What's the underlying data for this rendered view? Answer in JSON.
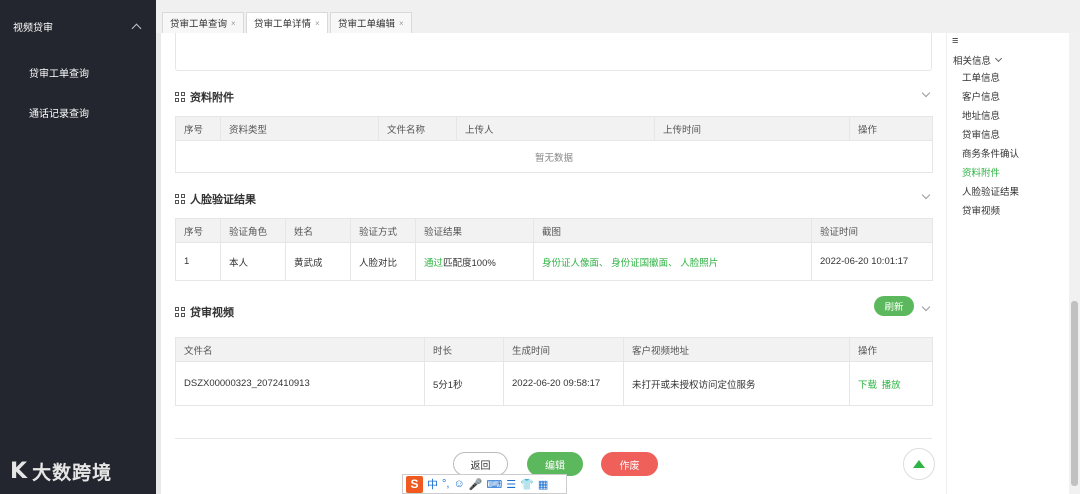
{
  "sidebar": {
    "group_label": "视频贷审",
    "items": [
      {
        "label": "贷审工单查询"
      },
      {
        "label": "通话记录查询"
      }
    ],
    "brand_mark": "K",
    "brand_text": "大数跨境"
  },
  "tabs": [
    {
      "label": "贷审工单查询"
    },
    {
      "label": "贷审工单详情"
    },
    {
      "label": "贷审工单编辑"
    }
  ],
  "tab_close_glyph": "×",
  "attachments": {
    "title": "资料附件",
    "columns": [
      "序号",
      "资料类型",
      "文件名称",
      "上传人",
      "上传时间",
      "操作"
    ],
    "empty_text": "暂无数据"
  },
  "face_verify": {
    "title": "人脸验证结果",
    "columns": [
      "序号",
      "验证角色",
      "姓名",
      "验证方式",
      "验证结果",
      "截图",
      "验证时间"
    ],
    "row": {
      "index": "1",
      "role": "本人",
      "name": "黄武成",
      "method": "人脸对比",
      "result_prefix": "通过",
      "result_suffix": "匹配度100%",
      "screenshots": "身份证人像面、 身份证国徽面、 人脸照片",
      "time": "2022-06-20 10:01:17"
    }
  },
  "video": {
    "title": "贷审视频",
    "refresh_label": "刷新",
    "columns": [
      "文件名",
      "时长",
      "生成时间",
      "客户视频地址",
      "操作"
    ],
    "row": {
      "filename": "DSZX00000323_2072410913",
      "duration": "5分1秒",
      "created": "2022-06-20 09:58:17",
      "address": "未打开或未授权访问定位服务",
      "action_download": "下载",
      "action_play": "播放"
    }
  },
  "actions": {
    "back": "返回",
    "edit": "编辑",
    "void": "作废"
  },
  "right_nav": {
    "menu_glyph": "≡",
    "heading": "相关信息",
    "items": [
      "工单信息",
      "客户信息",
      "地址信息",
      "贷审信息",
      "商务条件确认",
      "资料附件",
      "人脸验证结果",
      "贷审视频"
    ],
    "active_index": 5
  },
  "ime": {
    "logo": "S",
    "mode": "中",
    "punct": "°,"
  },
  "colors": {
    "accent_green": "#2fb344",
    "button_green": "#5cb85c",
    "button_red": "#f0605a",
    "sidebar_bg": "#23262e"
  }
}
